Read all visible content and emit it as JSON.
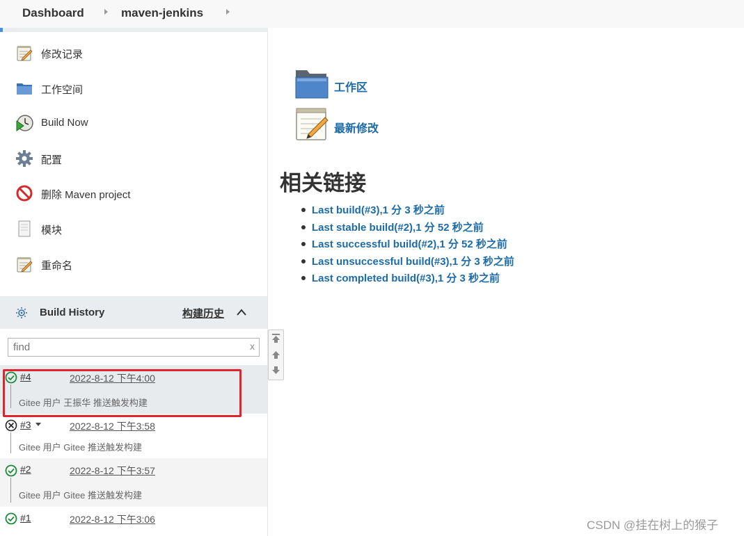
{
  "breadcrumb": {
    "items": [
      "Dashboard",
      "maven-jenkins"
    ]
  },
  "sidebar": {
    "tasks": [
      {
        "label": "修改记录",
        "icon": "notepad-icon"
      },
      {
        "label": "工作空间",
        "icon": "folder-icon"
      },
      {
        "label": "Build Now",
        "icon": "clock-play-icon"
      },
      {
        "label": "配置",
        "icon": "gear-icon"
      },
      {
        "label": "删除 Maven project",
        "icon": "no-entry-icon"
      },
      {
        "label": "模块",
        "icon": "document-icon"
      },
      {
        "label": "重命名",
        "icon": "notepad-icon"
      }
    ]
  },
  "build_history": {
    "title": "Build History",
    "trend_link": "构建历史",
    "search_placeholder": "find",
    "clear_label": "x",
    "builds": [
      {
        "number": "#4",
        "time": "2022-8-12 下午4:00",
        "cause": "Gitee 用户 王振华 推送触发构建",
        "status": "success"
      },
      {
        "number": "#3",
        "time": "2022-8-12 下午3:58",
        "cause": "Gitee 用户 Gitee 推送触发构建",
        "status": "failed"
      },
      {
        "number": "#2",
        "time": "2022-8-12 下午3:57",
        "cause": "Gitee 用户 Gitee 推送触发构建",
        "status": "success"
      },
      {
        "number": "#1",
        "time": "2022-8-12 下午3:06",
        "cause": "",
        "status": "success"
      }
    ]
  },
  "main": {
    "workspace_label": "工作区",
    "changes_label": "最新修改",
    "related_title": "相关链接",
    "links": [
      "Last build(#3),1 分 3 秒之前",
      "Last stable build(#2),1 分 52 秒之前",
      "Last successful build(#2),1 分 52 秒之前",
      "Last unsuccessful build(#3),1 分 3 秒之前",
      "Last completed build(#3),1 分 3 秒之前"
    ]
  },
  "watermark": "CSDN @挂在树上的猴子",
  "colors": {
    "link": "#1c6ba7",
    "success": "#1e8a3a",
    "highlight": "#e0232c"
  }
}
